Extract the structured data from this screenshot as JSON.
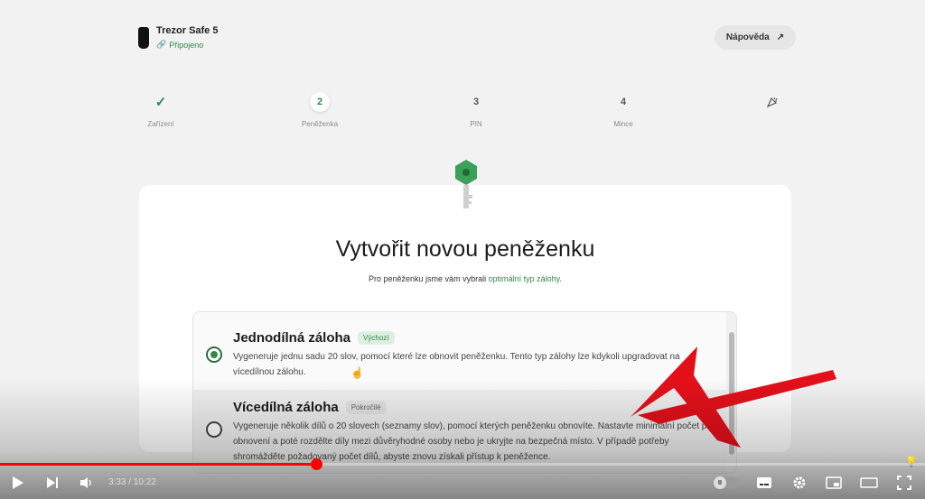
{
  "device": {
    "name": "Trezor Safe 5",
    "status": "Připojeno"
  },
  "header": {
    "help_label": "Nápověda",
    "help_icon": "arrow-up-right-icon"
  },
  "stepper": {
    "steps": [
      {
        "number": "",
        "label": "Zařízení",
        "state": "done"
      },
      {
        "number": "2",
        "label": "Peněženka",
        "state": "active"
      },
      {
        "number": "3",
        "label": "PIN",
        "state": "pending"
      },
      {
        "number": "4",
        "label": "Mince",
        "state": "pending"
      },
      {
        "number": "",
        "label": "",
        "state": "final",
        "icon": "confetti-icon"
      }
    ]
  },
  "main": {
    "title": "Vytvořit novou peněženku",
    "subtitle_prefix": "Pro peněženku jsme vám vybrali ",
    "subtitle_link": "optimální typ zálohy",
    "subtitle_suffix": ".",
    "options": [
      {
        "title": "Jednodílná záloha",
        "badge": "Výchozí",
        "selected": true,
        "description": "Vygeneruje jednu sadu 20 slov, pomocí které lze obnovit peněženku. Tento typ zálohy lze kdykoli upgradovat na vícedílnou zálohu."
      },
      {
        "title": "Vícedílná záloha",
        "badge": "Pokročilé",
        "selected": false,
        "description": "Vygeneruje několik dílů o 20 slovech (seznamy slov), pomocí kterých peněženku obnovíte. Nastavte minimální počet pro obnovení a poté rozdělte díly mezi důvěryhodné osoby nebo je ukryjte na bezpečná místo. V případě potřeby shromážděte požadovaný počet dílů, abyste znovu získali přístup k peněžence."
      }
    ]
  },
  "player": {
    "time": "3:33 / 10:22",
    "progress": 0.342,
    "accent_color": "#ff0000"
  },
  "colors": {
    "brand_green": "#2f8a4c",
    "arrow_red": "#e3101a"
  }
}
